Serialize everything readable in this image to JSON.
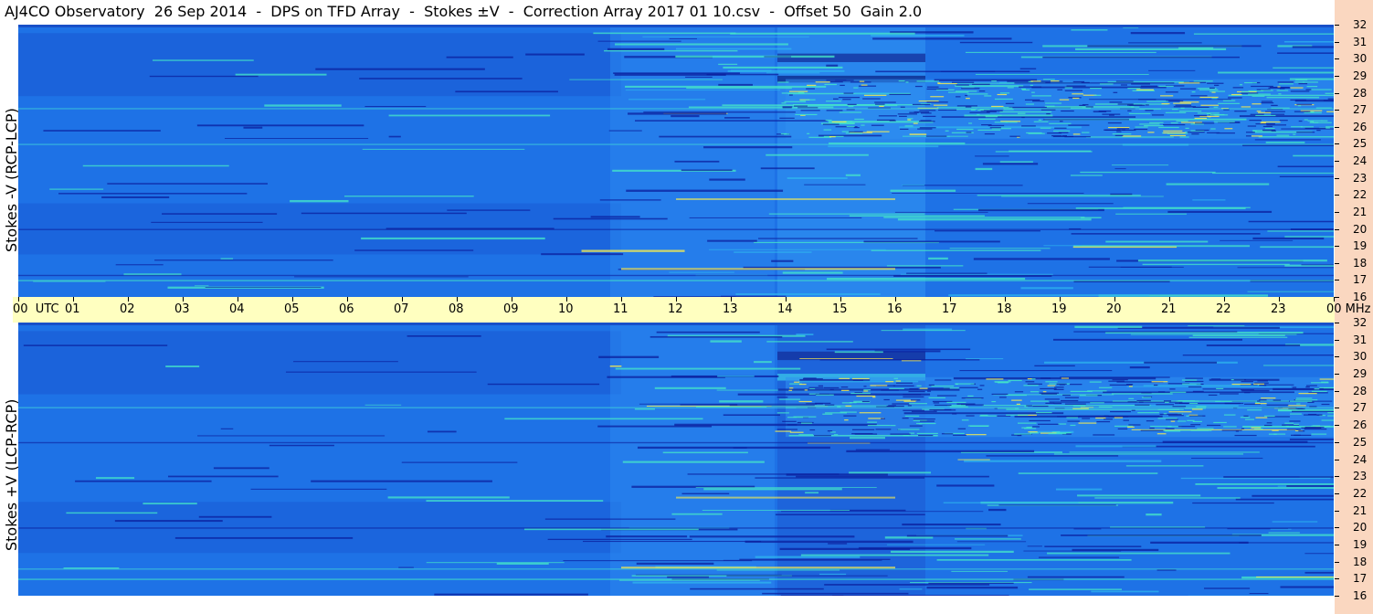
{
  "title": "AJ4CO Observatory  26 Sep 2014  -  DPS on TFD Array  -  Stokes ±V  -  Correction Array 2017 01 10.csv  -  Offset 50  Gain 2.0",
  "panels": [
    {
      "label": "Stokes -V (RCP-LCP)"
    },
    {
      "label": "Stokes +V (LCP-RCP)"
    }
  ],
  "time_axis": {
    "ticks": [
      "00  UTC",
      "01",
      "02",
      "03",
      "04",
      "05",
      "06",
      "07",
      "08",
      "09",
      "10",
      "11",
      "12",
      "13",
      "14",
      "15",
      "16",
      "17",
      "18",
      "19",
      "20",
      "21",
      "22",
      "23",
      "00 MHz"
    ]
  },
  "freq_axis": {
    "ticks": [
      "32",
      "31",
      "30",
      "29",
      "28",
      "27",
      "26",
      "25",
      "24",
      "23",
      "22",
      "21",
      "20",
      "19",
      "18",
      "17",
      "16"
    ]
  },
  "chart_data": {
    "type": "heatmap",
    "title": "AJ4CO Observatory  26 Sep 2014  -  DPS on TFD Array  -  Stokes ±V  -  Correction Array 2017 01 10.csv  -  Offset 50  Gain 2.0",
    "x_ticks": [
      "00",
      "01",
      "02",
      "03",
      "04",
      "05",
      "06",
      "07",
      "08",
      "09",
      "10",
      "11",
      "12",
      "13",
      "14",
      "15",
      "16",
      "17",
      "18",
      "19",
      "20",
      "21",
      "22",
      "23",
      "00"
    ],
    "xlim": [
      0,
      24
    ],
    "y_ticks": [
      32,
      31,
      30,
      29,
      28,
      27,
      26,
      25,
      24,
      23,
      22,
      21,
      20,
      19,
      18,
      17,
      16
    ],
    "ylim": [
      16,
      32
    ],
    "colors": {
      "low": "#0b1f9e",
      "mid": "#1f7fe8",
      "high": "#45e8c8",
      "peak": "#fff04a"
    },
    "series": [
      {
        "name": "Stokes -V (RCP-LCP)"
      },
      {
        "name": "Stokes +V (LCP-RCP)"
      }
    ]
  }
}
